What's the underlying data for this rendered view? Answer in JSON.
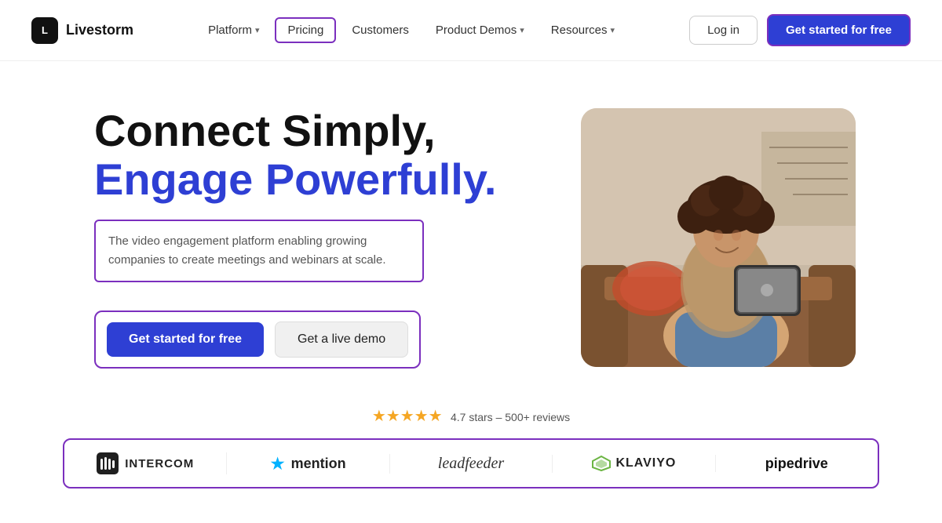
{
  "nav": {
    "logo_text": "Livestorm",
    "links": [
      {
        "id": "platform",
        "label": "Platform",
        "has_dropdown": true
      },
      {
        "id": "pricing",
        "label": "Pricing",
        "has_dropdown": false,
        "active": true
      },
      {
        "id": "customers",
        "label": "Customers",
        "has_dropdown": false
      },
      {
        "id": "product-demos",
        "label": "Product Demos",
        "has_dropdown": true
      },
      {
        "id": "resources",
        "label": "Resources",
        "has_dropdown": true
      }
    ],
    "login_label": "Log in",
    "cta_label": "Get started for free"
  },
  "hero": {
    "title_line1": "Connect Simply,",
    "title_line2": "Engage Powerfully.",
    "description": "The video engagement platform enabling growing companies to create meetings and webinars at scale.",
    "cta_primary": "Get started for free",
    "cta_secondary": "Get a live demo"
  },
  "social_proof": {
    "stars": "★★★★★",
    "rating": "4.7 stars",
    "reviews": "500+ reviews"
  },
  "logos": [
    {
      "id": "intercom",
      "label": "INTERCOM",
      "type": "intercom"
    },
    {
      "id": "mention",
      "label": "mention",
      "type": "mention"
    },
    {
      "id": "leadfeeder",
      "label": "leadfeeder",
      "type": "leadfeeder"
    },
    {
      "id": "klaviyo",
      "label": "KLAVIYO",
      "type": "klaviyo"
    },
    {
      "id": "pipedrive",
      "label": "pipedrive",
      "type": "pipedrive"
    }
  ]
}
